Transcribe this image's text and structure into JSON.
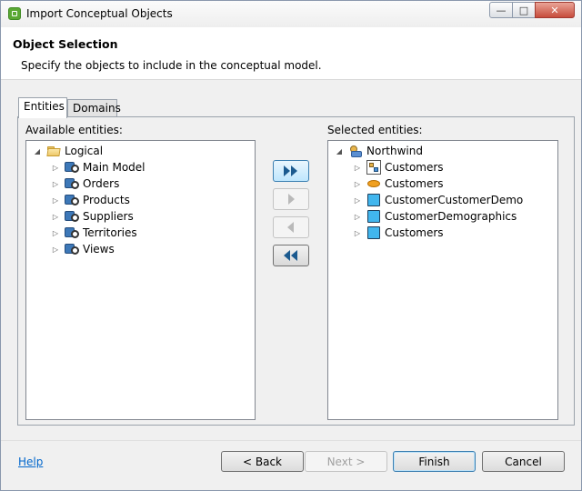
{
  "window": {
    "title": "Import Conceptual Objects",
    "minimize_glyph": "—",
    "maximize_glyph": "□",
    "close_glyph": "✕"
  },
  "header": {
    "title": "Object Selection",
    "description": "Specify the objects to include in the conceptual model."
  },
  "tabs": [
    {
      "label": "Entities",
      "active": true
    },
    {
      "label": "Domains",
      "active": false
    }
  ],
  "available": {
    "label": "Available entities:",
    "root": {
      "label": "Logical",
      "icon": "folder-open-icon",
      "expanded": true
    },
    "items": [
      {
        "label": "Main Model",
        "icon": "model-icon"
      },
      {
        "label": "Orders",
        "icon": "model-icon"
      },
      {
        "label": "Products",
        "icon": "model-icon"
      },
      {
        "label": "Suppliers",
        "icon": "model-icon"
      },
      {
        "label": "Territories",
        "icon": "model-icon"
      },
      {
        "label": "Views",
        "icon": "model-icon"
      }
    ]
  },
  "selected": {
    "label": "Selected entities:",
    "root": {
      "label": "Northwind",
      "icon": "database-icon",
      "expanded": true
    },
    "items": [
      {
        "label": "Customers",
        "icon": "relationship-entity-icon"
      },
      {
        "label": "Customers",
        "icon": "ellipse-entity-icon"
      },
      {
        "label": "CustomerCustomerDemo",
        "icon": "table-entity-icon"
      },
      {
        "label": "CustomerDemographics",
        "icon": "table-entity-icon"
      },
      {
        "label": "Customers",
        "icon": "table-entity-icon"
      }
    ]
  },
  "move_buttons": [
    {
      "name": "add-all-button",
      "icon": "double-right-arrow-icon",
      "enabled": true
    },
    {
      "name": "add-button",
      "icon": "right-arrow-icon",
      "enabled": false
    },
    {
      "name": "remove-button",
      "icon": "left-arrow-icon",
      "enabled": false
    },
    {
      "name": "remove-all-button",
      "icon": "double-left-arrow-icon",
      "enabled": true
    }
  ],
  "footer": {
    "help": "Help",
    "back": "< Back",
    "next": "Next >",
    "finish": "Finish",
    "cancel": "Cancel"
  },
  "colors": {
    "accent": "#3c7fb1",
    "arrow_active": "#1b5a8f",
    "arrow_disabled": "#b9b9b9",
    "link": "#0066cc"
  }
}
